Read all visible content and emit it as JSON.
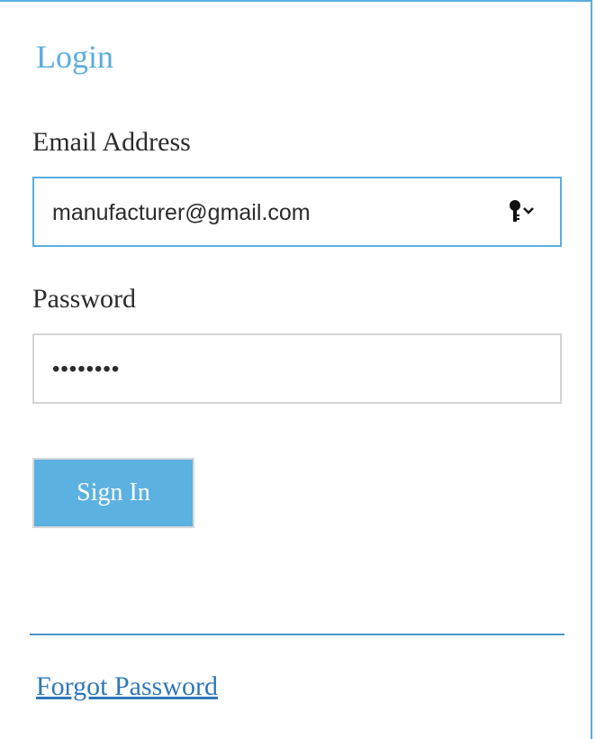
{
  "form": {
    "title": "Login",
    "email_label": "Email Address",
    "email_value": "manufacturer@gmail.com",
    "password_label": "Password",
    "password_value": "••••••••",
    "signin_label": "Sign In",
    "forgot_label": "Forgot Password"
  },
  "icons": {
    "password_manager": "key-chevron-icon"
  },
  "colors": {
    "accent": "#5aaedc",
    "button_bg": "#5bb1e0",
    "link": "#2f78b7",
    "divider": "#4a94c8",
    "text": "#2b2b2b",
    "field_border": "#d4d4d4"
  }
}
